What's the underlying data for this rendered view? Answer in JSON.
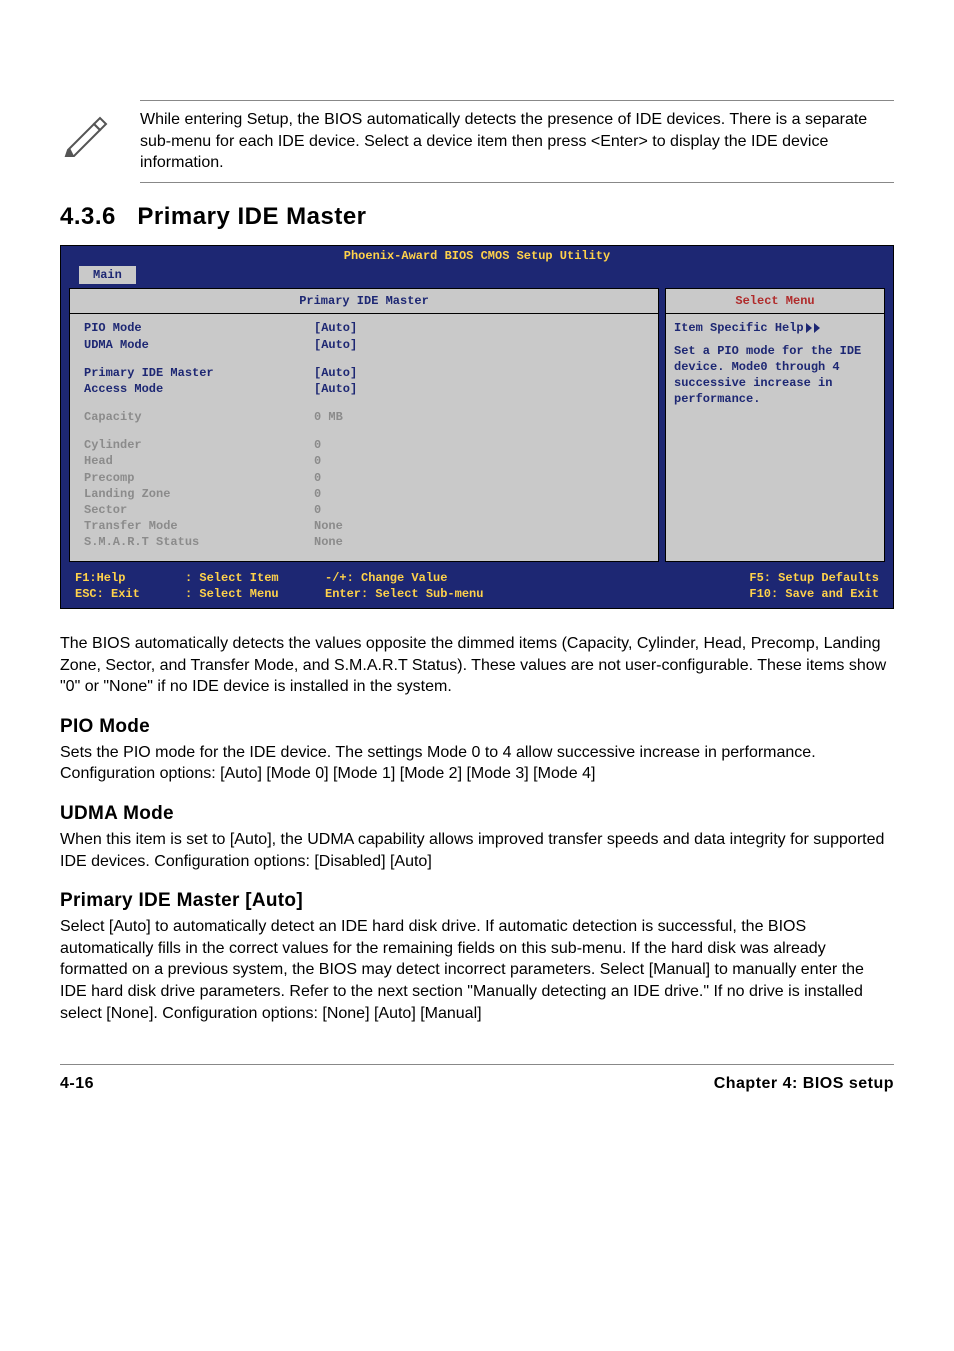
{
  "note": {
    "text": "While entering Setup, the BIOS automatically detects the presence of IDE devices. There is a separate sub-menu for each IDE device. Select a device item then press <Enter> to display the IDE device information."
  },
  "section": {
    "number": "4.3.6",
    "title": "Primary IDE Master"
  },
  "bios": {
    "title": "Phoenix-Award BIOS CMOS Setup Utility",
    "tab": "Main",
    "panel_title": "Primary IDE Master",
    "help_panel_title": "Select Menu",
    "rows": {
      "pio_mode": {
        "label": "PIO Mode",
        "value": "[Auto]"
      },
      "udma_mode": {
        "label": "UDMA Mode",
        "value": "[Auto]"
      },
      "primary_ide_master": {
        "label": "Primary IDE Master",
        "value": "[Auto]"
      },
      "access_mode": {
        "label": "Access Mode",
        "value": "[Auto]"
      },
      "capacity": {
        "label": "Capacity",
        "value": "0 MB"
      },
      "cylinder": {
        "label": "Cylinder",
        "value": "0"
      },
      "head": {
        "label": "Head",
        "value": "0"
      },
      "precomp": {
        "label": "Precomp",
        "value": "0"
      },
      "landing_zone": {
        "label": "Landing Zone",
        "value": "0"
      },
      "sector": {
        "label": "Sector",
        "value": "0"
      },
      "transfer_mode": {
        "label": "Transfer Mode",
        "value": "None"
      },
      "smart_status": {
        "label": "S.M.A.R.T Status",
        "value": "None"
      }
    },
    "help": {
      "heading": "Item Specific Help",
      "text": "Set a PIO mode for the IDE device. Mode0 through 4 successive increase in performance."
    },
    "footer": {
      "f1": "F1:Help",
      "esc": "ESC: Exit",
      "updown_a": ": Select Item",
      "updown_b": ": Select Menu",
      "change": "-/+: Change Value",
      "enter": "Enter: Select Sub-menu",
      "f5": "F5: Setup Defaults",
      "f10": "F10: Save and Exit"
    }
  },
  "para1": "The BIOS automatically detects the values opposite the dimmed items (Capacity, Cylinder, Head, Precomp, Landing Zone, Sector, and Transfer Mode, and S.M.A.R.T Status). These values are not user-configurable. These items show \"0\" or \"None\" if no IDE device is installed in the system.",
  "pio": {
    "heading": "PIO Mode",
    "text": "Sets the PIO mode for the IDE device. The settings Mode 0 to 4 allow successive increase in performance. Configuration options: [Auto] [Mode 0] [Mode 1] [Mode 2] [Mode 3] [Mode 4]"
  },
  "udma": {
    "heading": "UDMA Mode",
    "text": "When this item is set to [Auto], the UDMA capability allows improved transfer speeds and data integrity for supported IDE devices. Configuration options: [Disabled] [Auto]"
  },
  "primary": {
    "heading": "Primary IDE Master [Auto]",
    "text": "Select [Auto] to automatically detect an IDE hard disk drive. If automatic detection is successful, the BIOS automatically fills in the correct values for the remaining fields on this sub-menu. If the hard disk was already formatted on a previous system, the BIOS may detect incorrect parameters. Select [Manual] to manually enter the IDE hard disk drive parameters. Refer to the next section \"Manually detecting an IDE drive.\" If no drive is installed select [None]. Configuration options: [None] [Auto] [Manual]"
  },
  "footer": {
    "left": "4-16",
    "right": "Chapter 4: BIOS setup"
  }
}
